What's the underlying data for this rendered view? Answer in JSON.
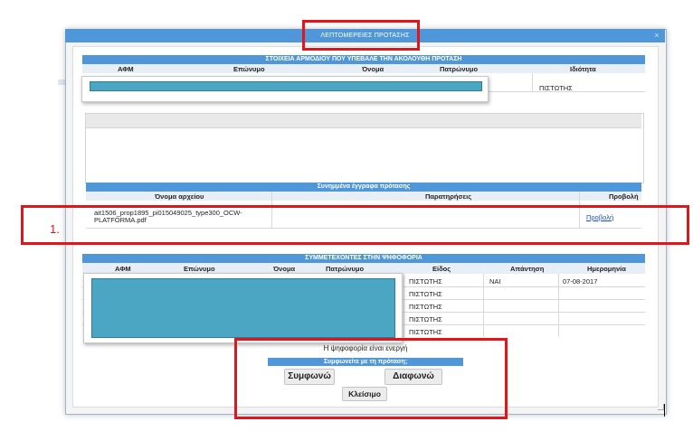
{
  "dialog": {
    "title": "ΛΕΠΤΟΜΕΡΕΙΕΣ ΠΡΟΤΑΣΗΣ",
    "close_symbol": "×"
  },
  "proposer_section": {
    "header": "ΣΤΟΙΧΕΙΑ ΑΡΜΟΔΙΟΥ ΠΟΥ ΥΠΕΒΑΛΕ ΤΗΝ ΑΚΟΛΟΥΘΗ ΠΡΟΤΑΣΗ",
    "columns": [
      "ΑΦΜ",
      "Επώνυμο",
      "Όνομα",
      "Πατρώνυμο",
      "Ιδιότητα"
    ],
    "row": {
      "role": "ΠΙΣΤΩΤΗΣ"
    }
  },
  "attachments": {
    "header": "Συνημμένα έγγραφα πρότασης",
    "columns": [
      "Όνομα αρχείου",
      "Παρατηρήσεις",
      "Προβολή"
    ],
    "rows": [
      {
        "filename_line1": "ait1506_prop1895_pi015049025_type300_OCW-",
        "filename_line2": "PLATFORMA.pdf",
        "notes": "",
        "view": "Προβολή"
      }
    ]
  },
  "voting": {
    "header": "ΣΥΜΜΕΤΕΧΟΝΤΕΣ ΣΤΗΝ ΨΗΦΟΦΟΡΙΑ",
    "columns": [
      "ΑΦΜ",
      "Επώνυμο",
      "Όνομα",
      "Πατρώνυμο",
      "Είδος",
      "Απάντηση",
      "Ημερομηνία"
    ],
    "rows": [
      {
        "type": "ΠΙΣΤΩΤΗΣ",
        "answer": "ΝΑΙ",
        "date": "07-08-2017"
      },
      {
        "type": "ΠΙΣΤΩΤΗΣ",
        "answer": "",
        "date": ""
      },
      {
        "type": "ΠΙΣΤΩΤΗΣ",
        "answer": "",
        "date": ""
      },
      {
        "type": "ΠΙΣΤΩΤΗΣ",
        "answer": "",
        "date": ""
      },
      {
        "type": "ΠΙΣΤΩΤΗΣ",
        "answer": "",
        "date": ""
      }
    ]
  },
  "vote_panel": {
    "status": "Η ψηφοφορία είναι ενεργή",
    "question": "Συμφωνείτε με τη πρόταση;",
    "agree_label": "Συμφωνώ",
    "disagree_label": "Διαφωνώ",
    "close_label": "Κλείσιμο"
  },
  "annotations": {
    "marker_label": "1.",
    "highlight_color": "#e3141a",
    "accent_color": "#4f97d9",
    "redacted_color": "#4aa6c2"
  }
}
